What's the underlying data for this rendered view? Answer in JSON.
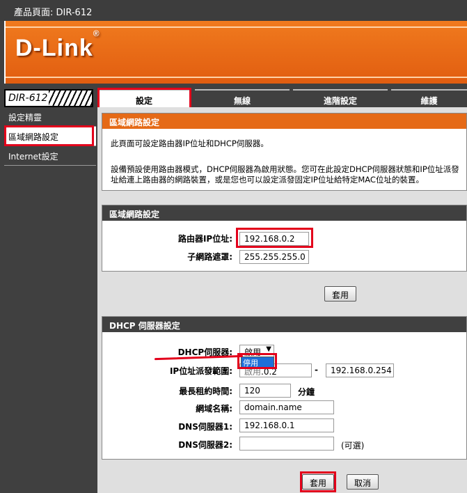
{
  "top_bar": {
    "product_page": "產品頁面: DIR-612"
  },
  "brand": {
    "logo": "D-Link",
    "registered": "®"
  },
  "model": "DIR-612",
  "tabs": [
    {
      "label": "設定",
      "active": true
    },
    {
      "label": "無線",
      "active": false
    },
    {
      "label": "進階設定",
      "active": false
    },
    {
      "label": "維護",
      "active": false
    }
  ],
  "sidebar": {
    "items": [
      {
        "label": "設定精靈"
      },
      {
        "label": "區域網路設定"
      },
      {
        "label": "Internet設定"
      }
    ]
  },
  "intro": {
    "title": "區域網路設定",
    "line1": "此頁面可設定路由器IP位址和DHCP伺服器。",
    "line2": "設備預設使用路由器模式，DHCP伺服器為啟用狀態。您可在此設定DHCP伺服器狀態和IP位址派發",
    "line3": "址給連上路由器的網路裝置，或是您也可以設定派發固定IP位址給特定MAC位址的裝置。"
  },
  "lan": {
    "title": "區域網路設定",
    "router_ip_label": "路由器IP位址:",
    "router_ip": "192.168.0.2",
    "subnet_label": "子網路遮罩:",
    "subnet": "255.255.255.0",
    "apply": "套用"
  },
  "dhcp": {
    "title": "DHCP 伺服器設定",
    "server_label": "DHCP伺服器:",
    "server_value": "啟用",
    "dropdown_option": "停用",
    "range_label": "IP位址派發範圍:",
    "range_start_hidden": "啟用",
    "range_start": ".0.2",
    "range_sep": "-",
    "range_end": "192.168.0.254",
    "lease_label": "最長租約時間:",
    "lease": "120",
    "lease_unit": "分鐘",
    "domain_label": "網域名稱:",
    "domain": "domain.name",
    "dns1_label": "DNS伺服器1:",
    "dns1": "192.168.0.1",
    "dns2_label": "DNS伺服器2:",
    "dns2": "",
    "optional": "(可選)"
  },
  "footer": {
    "apply": "套用",
    "cancel": "取消"
  },
  "colors": {
    "highlight": "#e3001b",
    "header_orange": "#e56a17",
    "dark": "#404040"
  }
}
